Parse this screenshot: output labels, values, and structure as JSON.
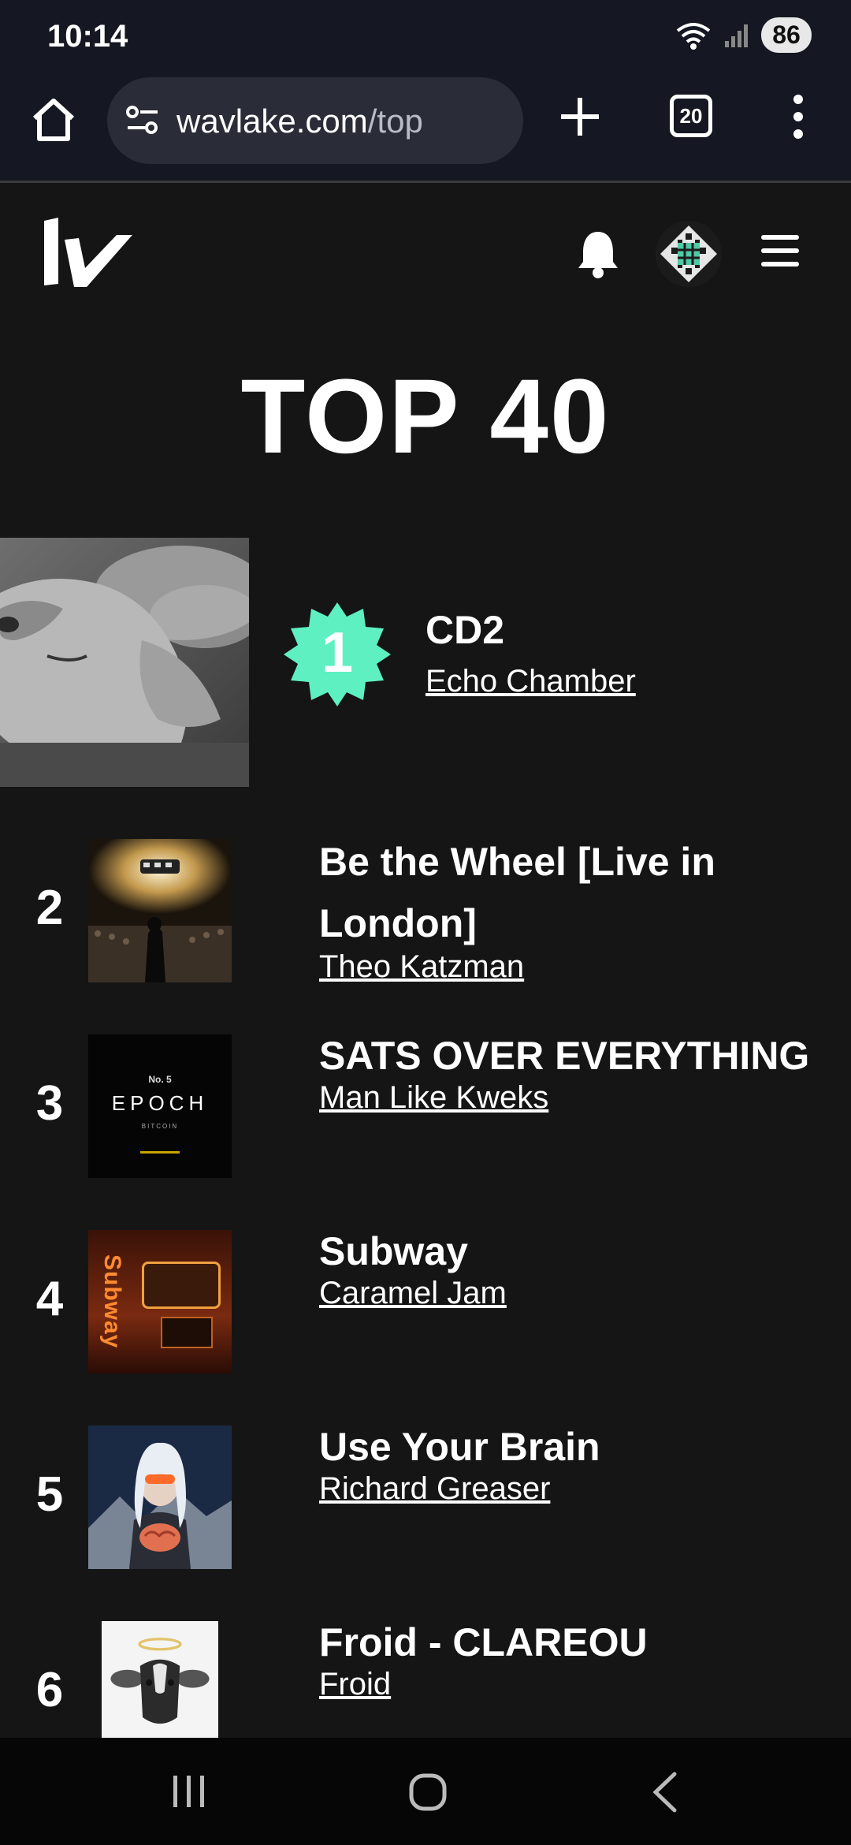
{
  "status_bar": {
    "time": "10:14",
    "battery": "86",
    "wifi_badge": "5"
  },
  "browser": {
    "url_domain": "wavlake.com",
    "url_path": "/top",
    "tab_count": "20"
  },
  "page": {
    "title": "TOP 40"
  },
  "featured": {
    "rank": "1",
    "title": "CD2",
    "artist": "Echo Chamber"
  },
  "tracks": [
    {
      "rank": "2",
      "title": "Be the Wheel [Live in London]",
      "artist": "Theo Katzman"
    },
    {
      "rank": "3",
      "title": "SATS OVER EVERYTHING",
      "artist": "Man Like Kweks",
      "art_text": {
        "number": "No. 5",
        "word": "EPOCH",
        "sub": "BITCOIN"
      }
    },
    {
      "rank": "4",
      "title": "Subway",
      "artist": "Caramel Jam",
      "art_text": {
        "word": "Subway"
      }
    },
    {
      "rank": "5",
      "title": "Use Your Brain",
      "artist": "Richard Greaser"
    },
    {
      "rank": "6",
      "title": "Froid - CLAREOU",
      "artist": "Froid"
    }
  ],
  "colors": {
    "accent": "#5ef0c1",
    "background": "#151515",
    "browser_chrome": "#151822"
  }
}
